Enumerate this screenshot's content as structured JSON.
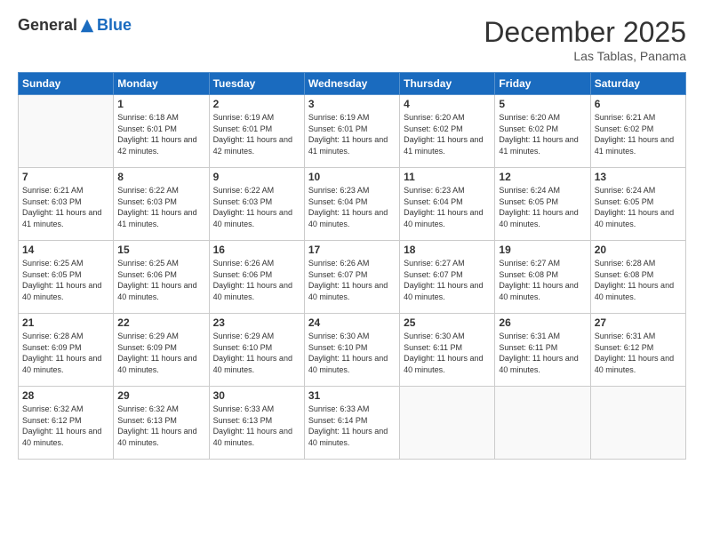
{
  "header": {
    "logo_general": "General",
    "logo_blue": "Blue",
    "month_title": "December 2025",
    "location": "Las Tablas, Panama"
  },
  "weekdays": [
    "Sunday",
    "Monday",
    "Tuesday",
    "Wednesday",
    "Thursday",
    "Friday",
    "Saturday"
  ],
  "weeks": [
    [
      {
        "day": "",
        "sunrise": "",
        "sunset": "",
        "daylight": ""
      },
      {
        "day": "1",
        "sunrise": "Sunrise: 6:18 AM",
        "sunset": "Sunset: 6:01 PM",
        "daylight": "Daylight: 11 hours and 42 minutes."
      },
      {
        "day": "2",
        "sunrise": "Sunrise: 6:19 AM",
        "sunset": "Sunset: 6:01 PM",
        "daylight": "Daylight: 11 hours and 42 minutes."
      },
      {
        "day": "3",
        "sunrise": "Sunrise: 6:19 AM",
        "sunset": "Sunset: 6:01 PM",
        "daylight": "Daylight: 11 hours and 41 minutes."
      },
      {
        "day": "4",
        "sunrise": "Sunrise: 6:20 AM",
        "sunset": "Sunset: 6:02 PM",
        "daylight": "Daylight: 11 hours and 41 minutes."
      },
      {
        "day": "5",
        "sunrise": "Sunrise: 6:20 AM",
        "sunset": "Sunset: 6:02 PM",
        "daylight": "Daylight: 11 hours and 41 minutes."
      },
      {
        "day": "6",
        "sunrise": "Sunrise: 6:21 AM",
        "sunset": "Sunset: 6:02 PM",
        "daylight": "Daylight: 11 hours and 41 minutes."
      }
    ],
    [
      {
        "day": "7",
        "sunrise": "Sunrise: 6:21 AM",
        "sunset": "Sunset: 6:03 PM",
        "daylight": "Daylight: 11 hours and 41 minutes."
      },
      {
        "day": "8",
        "sunrise": "Sunrise: 6:22 AM",
        "sunset": "Sunset: 6:03 PM",
        "daylight": "Daylight: 11 hours and 41 minutes."
      },
      {
        "day": "9",
        "sunrise": "Sunrise: 6:22 AM",
        "sunset": "Sunset: 6:03 PM",
        "daylight": "Daylight: 11 hours and 40 minutes."
      },
      {
        "day": "10",
        "sunrise": "Sunrise: 6:23 AM",
        "sunset": "Sunset: 6:04 PM",
        "daylight": "Daylight: 11 hours and 40 minutes."
      },
      {
        "day": "11",
        "sunrise": "Sunrise: 6:23 AM",
        "sunset": "Sunset: 6:04 PM",
        "daylight": "Daylight: 11 hours and 40 minutes."
      },
      {
        "day": "12",
        "sunrise": "Sunrise: 6:24 AM",
        "sunset": "Sunset: 6:05 PM",
        "daylight": "Daylight: 11 hours and 40 minutes."
      },
      {
        "day": "13",
        "sunrise": "Sunrise: 6:24 AM",
        "sunset": "Sunset: 6:05 PM",
        "daylight": "Daylight: 11 hours and 40 minutes."
      }
    ],
    [
      {
        "day": "14",
        "sunrise": "Sunrise: 6:25 AM",
        "sunset": "Sunset: 6:05 PM",
        "daylight": "Daylight: 11 hours and 40 minutes."
      },
      {
        "day": "15",
        "sunrise": "Sunrise: 6:25 AM",
        "sunset": "Sunset: 6:06 PM",
        "daylight": "Daylight: 11 hours and 40 minutes."
      },
      {
        "day": "16",
        "sunrise": "Sunrise: 6:26 AM",
        "sunset": "Sunset: 6:06 PM",
        "daylight": "Daylight: 11 hours and 40 minutes."
      },
      {
        "day": "17",
        "sunrise": "Sunrise: 6:26 AM",
        "sunset": "Sunset: 6:07 PM",
        "daylight": "Daylight: 11 hours and 40 minutes."
      },
      {
        "day": "18",
        "sunrise": "Sunrise: 6:27 AM",
        "sunset": "Sunset: 6:07 PM",
        "daylight": "Daylight: 11 hours and 40 minutes."
      },
      {
        "day": "19",
        "sunrise": "Sunrise: 6:27 AM",
        "sunset": "Sunset: 6:08 PM",
        "daylight": "Daylight: 11 hours and 40 minutes."
      },
      {
        "day": "20",
        "sunrise": "Sunrise: 6:28 AM",
        "sunset": "Sunset: 6:08 PM",
        "daylight": "Daylight: 11 hours and 40 minutes."
      }
    ],
    [
      {
        "day": "21",
        "sunrise": "Sunrise: 6:28 AM",
        "sunset": "Sunset: 6:09 PM",
        "daylight": "Daylight: 11 hours and 40 minutes."
      },
      {
        "day": "22",
        "sunrise": "Sunrise: 6:29 AM",
        "sunset": "Sunset: 6:09 PM",
        "daylight": "Daylight: 11 hours and 40 minutes."
      },
      {
        "day": "23",
        "sunrise": "Sunrise: 6:29 AM",
        "sunset": "Sunset: 6:10 PM",
        "daylight": "Daylight: 11 hours and 40 minutes."
      },
      {
        "day": "24",
        "sunrise": "Sunrise: 6:30 AM",
        "sunset": "Sunset: 6:10 PM",
        "daylight": "Daylight: 11 hours and 40 minutes."
      },
      {
        "day": "25",
        "sunrise": "Sunrise: 6:30 AM",
        "sunset": "Sunset: 6:11 PM",
        "daylight": "Daylight: 11 hours and 40 minutes."
      },
      {
        "day": "26",
        "sunrise": "Sunrise: 6:31 AM",
        "sunset": "Sunset: 6:11 PM",
        "daylight": "Daylight: 11 hours and 40 minutes."
      },
      {
        "day": "27",
        "sunrise": "Sunrise: 6:31 AM",
        "sunset": "Sunset: 6:12 PM",
        "daylight": "Daylight: 11 hours and 40 minutes."
      }
    ],
    [
      {
        "day": "28",
        "sunrise": "Sunrise: 6:32 AM",
        "sunset": "Sunset: 6:12 PM",
        "daylight": "Daylight: 11 hours and 40 minutes."
      },
      {
        "day": "29",
        "sunrise": "Sunrise: 6:32 AM",
        "sunset": "Sunset: 6:13 PM",
        "daylight": "Daylight: 11 hours and 40 minutes."
      },
      {
        "day": "30",
        "sunrise": "Sunrise: 6:33 AM",
        "sunset": "Sunset: 6:13 PM",
        "daylight": "Daylight: 11 hours and 40 minutes."
      },
      {
        "day": "31",
        "sunrise": "Sunrise: 6:33 AM",
        "sunset": "Sunset: 6:14 PM",
        "daylight": "Daylight: 11 hours and 40 minutes."
      },
      {
        "day": "",
        "sunrise": "",
        "sunset": "",
        "daylight": ""
      },
      {
        "day": "",
        "sunrise": "",
        "sunset": "",
        "daylight": ""
      },
      {
        "day": "",
        "sunrise": "",
        "sunset": "",
        "daylight": ""
      }
    ]
  ]
}
